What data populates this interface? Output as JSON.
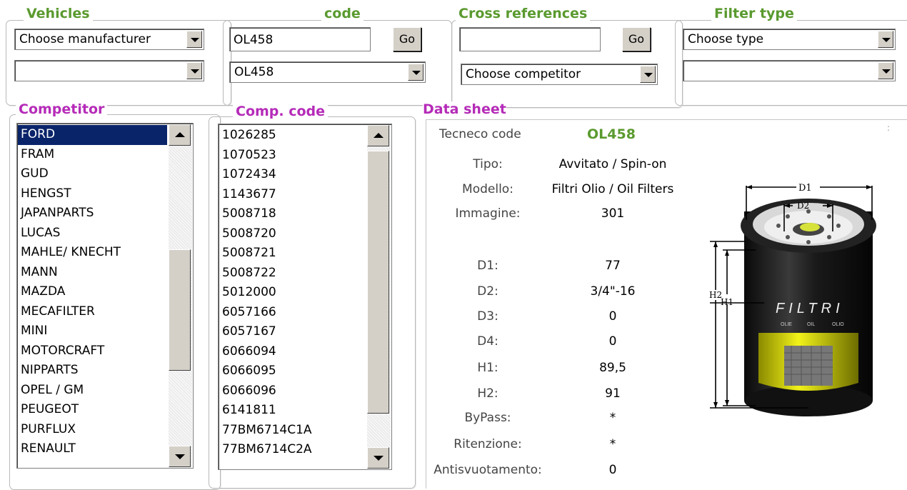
{
  "vehicles": {
    "legend": "Vehicles",
    "manufacturer_select": "Choose manufacturer",
    "model_select": ""
  },
  "code": {
    "legend": "code",
    "input_value": "OL458",
    "go_label": "Go",
    "select_value": "OL458"
  },
  "cross_references": {
    "legend": "Cross references",
    "input_value": "",
    "go_label": "Go",
    "competitor_select": "Choose competitor"
  },
  "filter_type": {
    "legend": "Filter type",
    "type_select": "Choose type",
    "subtype_select": ""
  },
  "competitor": {
    "legend": "Competitor",
    "selected": "FORD",
    "items": [
      "FORD",
      "FRAM",
      "GUD",
      "HENGST",
      "JAPANPARTS",
      "LUCAS",
      "MAHLE/ KNECHT",
      "MANN",
      "MAZDA",
      "MECAFILTER",
      "MINI",
      "MOTORCRAFT",
      "NIPPARTS",
      "OPEL / GM",
      "PEUGEOT",
      "PURFLUX",
      "RENAULT"
    ]
  },
  "comp_code": {
    "legend": "Comp. code",
    "items": [
      "1026285",
      "1070523",
      "1072434",
      "1143677",
      "5008718",
      "5008720",
      "5008721",
      "5008722",
      "5012000",
      "6057166",
      "6057167",
      "6066094",
      "6066095",
      "6066096",
      "6141811",
      "77BM6714C1A",
      "77BM6714C2A"
    ]
  },
  "data_sheet": {
    "legend": "Data sheet",
    "tecneco_label": "Tecneco code",
    "tecneco_value": "OL458",
    "rows": [
      {
        "label": "Tipo:",
        "value": "Avvitato / Spin-on"
      },
      {
        "label": "Modello:",
        "value": "Filtri Olio / Oil Filters"
      },
      {
        "label": "Immagine:",
        "value": "301"
      },
      {
        "label": "D1:",
        "value": "77"
      },
      {
        "label": "D2:",
        "value": "3/4\"-16"
      },
      {
        "label": "D3:",
        "value": "0"
      },
      {
        "label": "D4:",
        "value": "0"
      },
      {
        "label": "H1:",
        "value": "89,5"
      },
      {
        "label": "H2:",
        "value": "91"
      },
      {
        "label": "ByPass:",
        "value": "*"
      },
      {
        "label": "Ritenzione:",
        "value": "*"
      },
      {
        "label": "Antisvuotamento:",
        "value": "0"
      }
    ],
    "diagram": {
      "d1": "D1",
      "d2": "D2",
      "h1": "H1",
      "h2": "H2",
      "brand": "FILTRI",
      "sub1": "OLIE",
      "sub2": "OIL",
      "sub3": "OLIO"
    }
  }
}
